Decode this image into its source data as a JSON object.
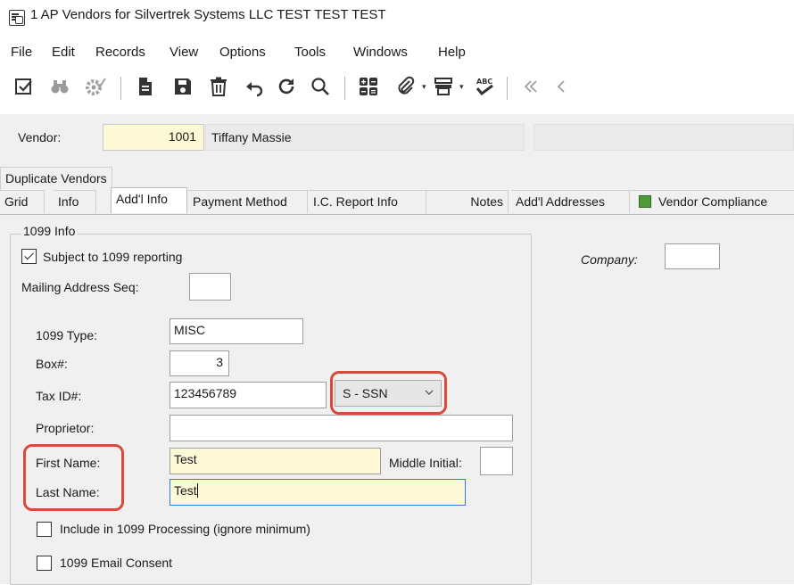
{
  "window": {
    "title": "1 AP Vendors for Silvertrek Systems LLC TEST TEST TEST"
  },
  "menu": [
    "File",
    "Edit",
    "Records",
    "View",
    "Options",
    "Tools",
    "Windows",
    "Help"
  ],
  "toolbar": {
    "icons": [
      "edit-check-icon",
      "binoculars-icon",
      "gear-check-icon",
      "new-document-icon",
      "save-icon",
      "delete-icon",
      "undo-icon",
      "refresh-icon",
      "search-icon",
      "calculator-icon",
      "attachment-icon",
      "print-icon",
      "spellcheck-icon",
      "first-record-icon",
      "previous-record-icon"
    ]
  },
  "vendor": {
    "label": "Vendor:",
    "id": "1001",
    "name": "Tiffany Massie"
  },
  "tabs": {
    "top": "Duplicate Vendors",
    "row": [
      "Grid",
      "Info",
      "Add'l Info",
      "Payment Method",
      "I.C. Report Info",
      "Notes",
      "Add'l Addresses",
      "Vendor Compliance"
    ],
    "active": "Add'l Info"
  },
  "form": {
    "group_title": "1099 Info",
    "subject_1099_label": "Subject to 1099 reporting",
    "subject_1099_checked": true,
    "mailing_label": "Mailing Address Seq:",
    "mailing_value": "",
    "type_label": "1099 Type:",
    "type_value": "MISC",
    "box_label": "Box#:",
    "box_value": "3",
    "taxid_label": "Tax ID#:",
    "taxid_value": "123456789",
    "taxid_type": "S - SSN",
    "proprietor_label": "Proprietor:",
    "proprietor_value": "",
    "first_label": "First Name:",
    "first_value": "Test",
    "middle_label": "Middle Initial:",
    "middle_value": "",
    "last_label": "Last Name:",
    "last_value": "Test",
    "include_label": "Include in 1099 Processing (ignore minimum)",
    "include_checked": false,
    "consent_label": "1099 Email Consent",
    "consent_checked": false
  },
  "company": {
    "label": "Company:",
    "value": ""
  },
  "colors": {
    "accent_callout": "#d64b3b",
    "required_field": "#fdf9d7",
    "panel_bg": "#f0f0f0"
  }
}
